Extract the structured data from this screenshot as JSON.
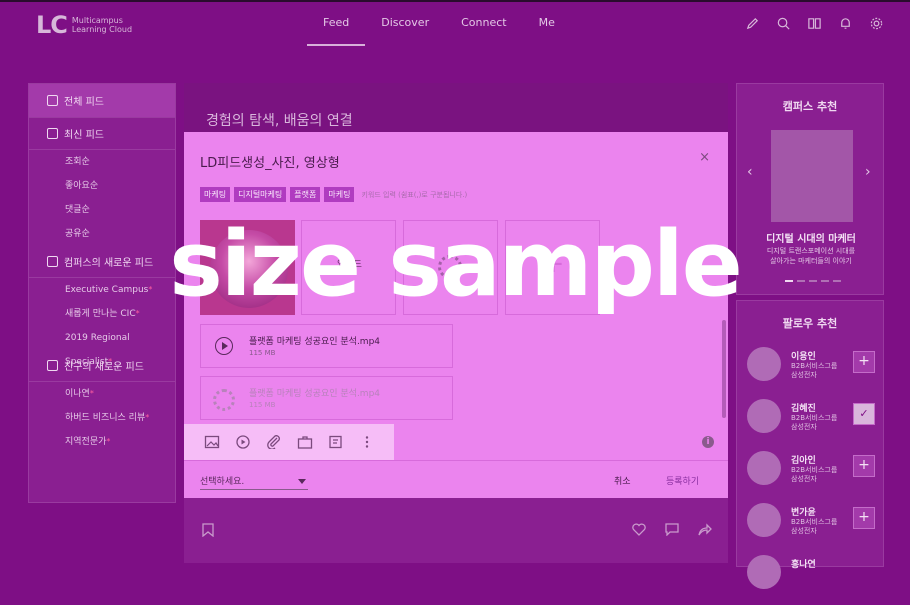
{
  "header": {
    "logo_mark": "LC",
    "logo_line1": "Multicampus",
    "logo_line2": "Learning Cloud",
    "nav": [
      "Feed",
      "Discover",
      "Connect",
      "Me"
    ],
    "icons": [
      "pencil-icon",
      "search-icon",
      "book-icon",
      "bell-icon",
      "gear-icon"
    ]
  },
  "sidebar": {
    "all_feed": "전체 피드",
    "recent_feed": "최신 피드",
    "sort": [
      "조회순",
      "좋아요순",
      "댓글순",
      "공유순"
    ],
    "campus_feed": "컴퍼스의 새로운 피드",
    "campus_items": [
      "Executive Campus",
      "새롭게 만나는 CIC",
      "2019 Regional Specialist"
    ],
    "friend_feed": "친구의 새로운 피드",
    "friend_items": [
      "이나연",
      "하버드 비즈니스 리뷰",
      "지역전문가"
    ]
  },
  "feed": {
    "banner_title": "경험의 탐색, 배움의 연결"
  },
  "campus_recommend": {
    "title": "캠퍼스 추천",
    "name": "디지털 시대의 마케터",
    "desc_line1": "디지털 트랜스포메이션 시대를",
    "desc_line2": "살아가는 마케터들의 이야기"
  },
  "follow_recommend": {
    "title": "팔로우 추천",
    "people": [
      {
        "name": "이용인",
        "dept": "B2B서비스그룹",
        "company": "삼성전자",
        "followed": false
      },
      {
        "name": "김혜진",
        "dept": "B2B서비스그룹",
        "company": "삼성전자",
        "followed": true
      },
      {
        "name": "김아인",
        "dept": "B2B서비스그룹",
        "company": "삼성전자",
        "followed": false
      },
      {
        "name": "변가윤",
        "dept": "B2B서비스그룹",
        "company": "삼성전자",
        "followed": false
      },
      {
        "name": "홍나연",
        "dept": "",
        "company": "",
        "followed": false
      }
    ]
  },
  "modal": {
    "title": "LD피드생성_사진, 영상형",
    "close": "×",
    "tags": [
      "마케팅",
      "디지털마케팅",
      "플랫폼",
      "마케팅"
    ],
    "tag_hint": "키워드 입력 (쉼표(,)로 구분됩니다.)",
    "upload_label": "업로드",
    "plus": "+",
    "files": [
      {
        "name": "플랫폼 마케팅 성공요인 분석.mp4",
        "size": "115 MB"
      },
      {
        "name": "플랫폼 마케팅 성공요인 분석.mp4",
        "size": "115 MB"
      }
    ],
    "select_placeholder": "선택하세요.",
    "cancel": "취소",
    "submit": "등록하기",
    "info": "i"
  },
  "watermark": "size sample"
}
